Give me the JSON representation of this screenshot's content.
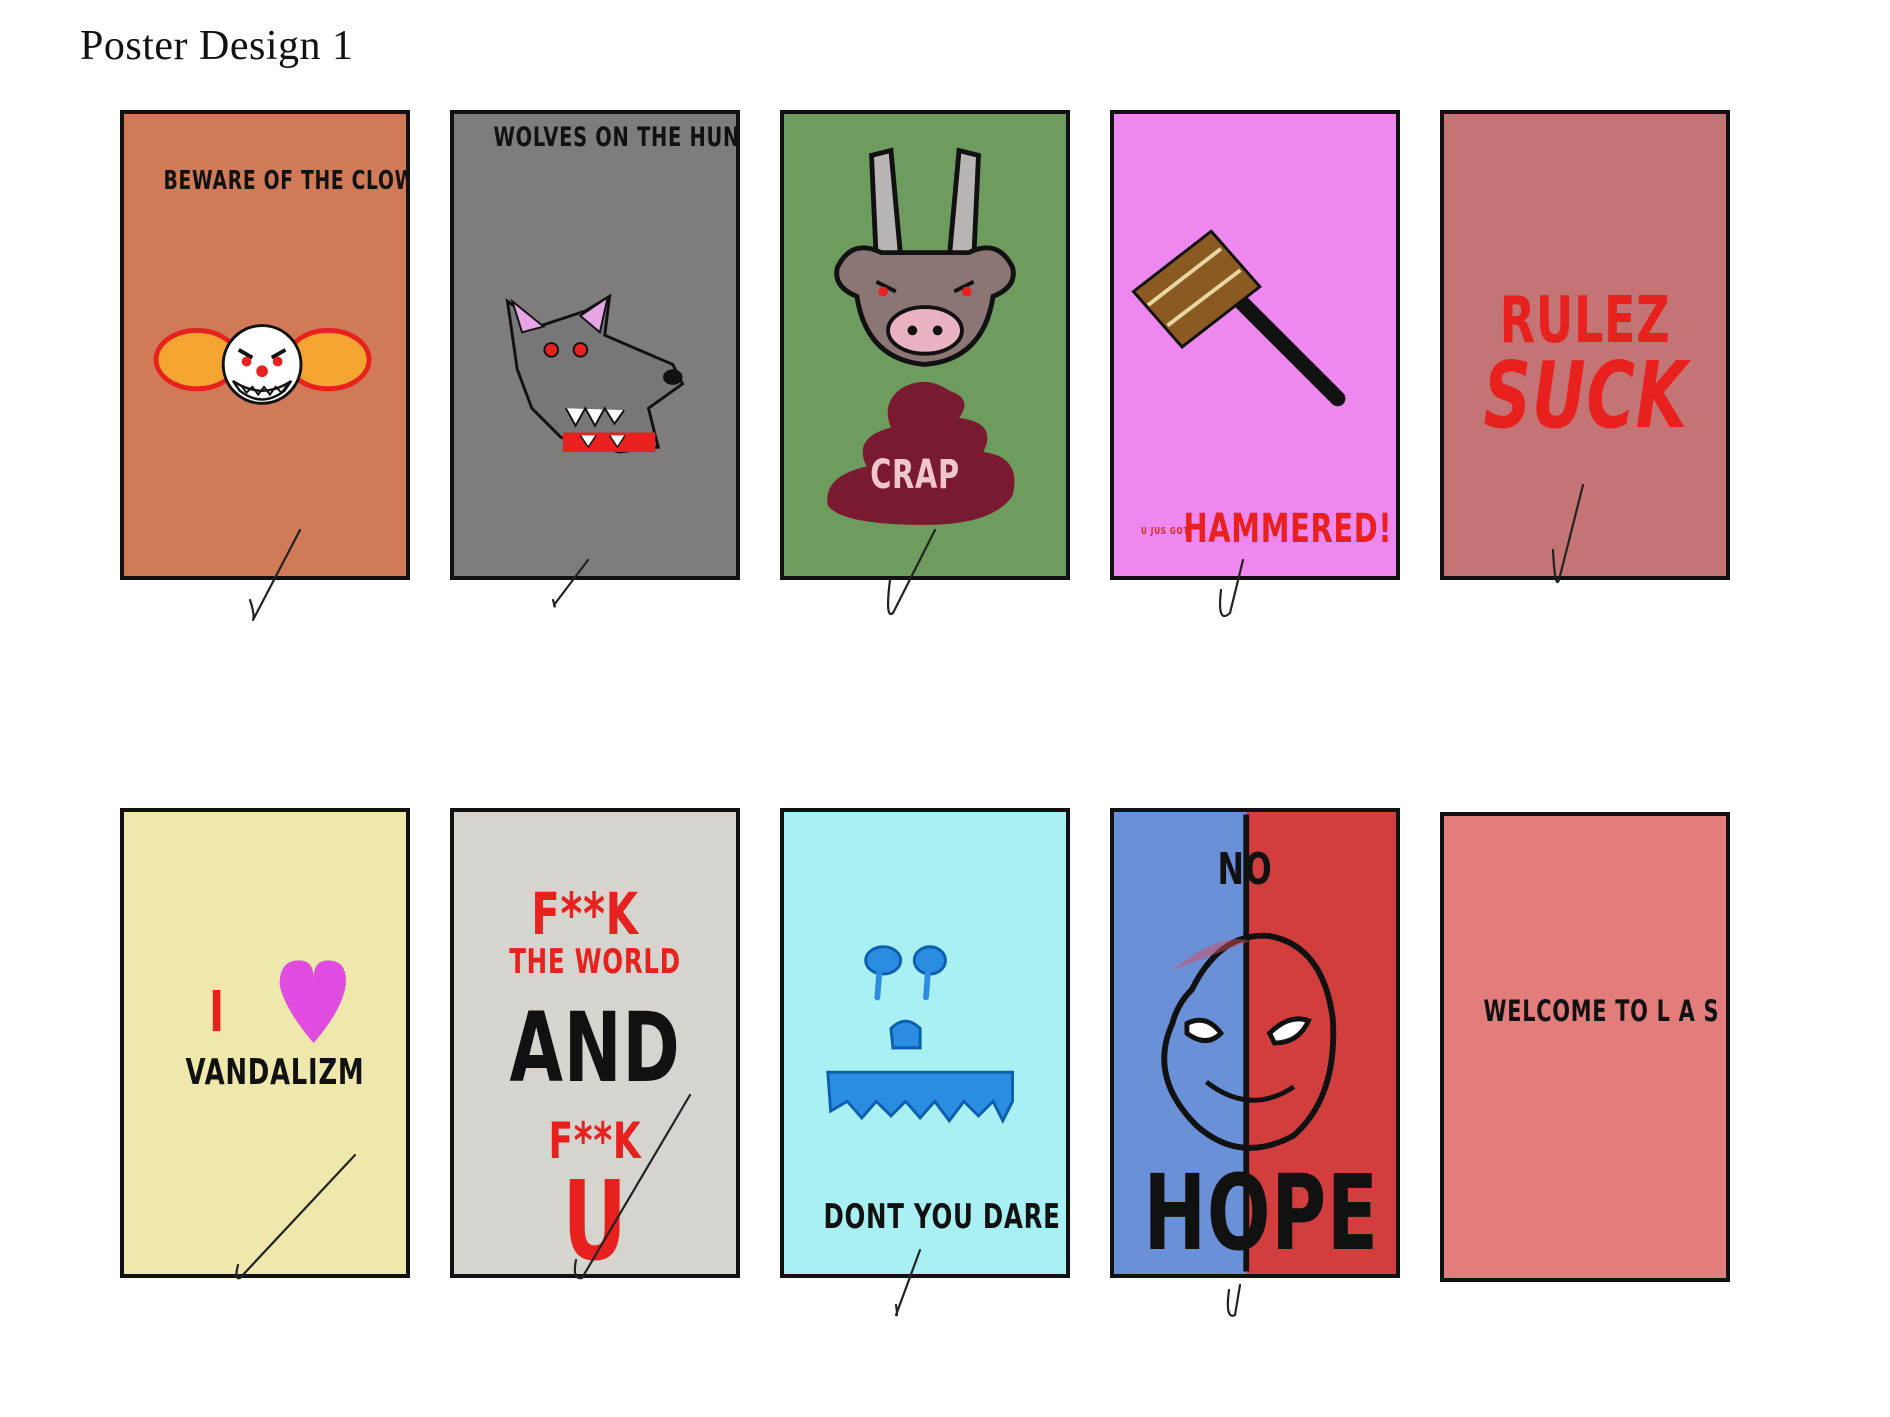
{
  "title": "Poster Design 1",
  "posters": [
    {
      "id": "clowns",
      "bg": "#d07a58",
      "text": "BEWARE OF THE CLOWNS"
    },
    {
      "id": "wolves",
      "bg": "#7f7c7c",
      "text": "WOLVES ON THE HUNT"
    },
    {
      "id": "crap",
      "bg": "#6e9b5e",
      "text": "CRAP"
    },
    {
      "id": "hammered",
      "bg": "#ee88ee",
      "text_small": "U JUS GOT",
      "text_big": "HAMMERED!"
    },
    {
      "id": "rulez",
      "bg": "#c47474",
      "line1": "RULEZ",
      "line2": "SUCK"
    },
    {
      "id": "vandalizm",
      "bg": "#efe8ad",
      "line1": "I",
      "line2": "VANDALIZM"
    },
    {
      "id": "world",
      "bg": "#d6d4cf",
      "line1": "F**K",
      "line2": "THE WORLD",
      "line3": "AND",
      "line4": "F**K",
      "line5": "U"
    },
    {
      "id": "cry",
      "bg": "#a8f0f4",
      "text": "DONT YOU DARE CRY"
    },
    {
      "id": "hope",
      "bg_left": "#6a90d8",
      "bg_right": "#d23e3e",
      "line1": "NO",
      "line2": "HOPE"
    },
    {
      "id": "vegas",
      "bg": "#e27d7b",
      "text": "WELCOME TO L A S VEGAS"
    }
  ],
  "colors": {
    "border": "#111111",
    "red": "#e8201e",
    "pink": "#e04ce0"
  }
}
